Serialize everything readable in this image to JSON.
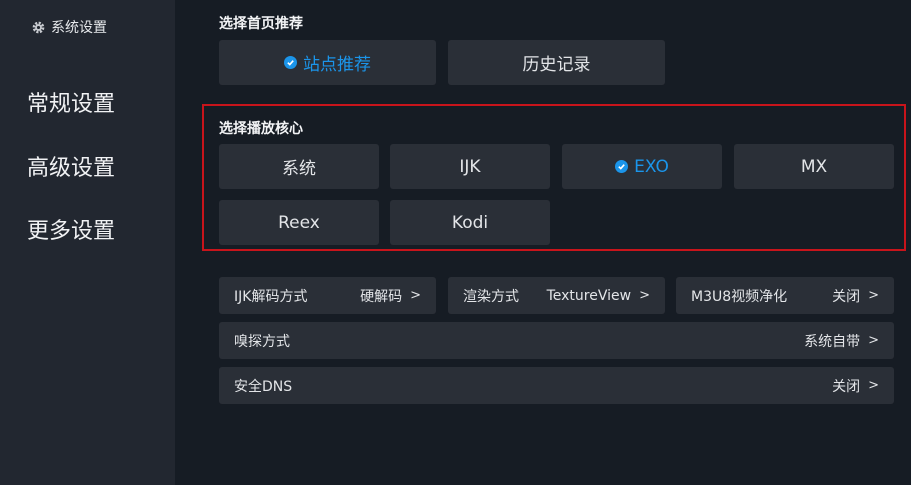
{
  "sidebar": {
    "title": "系统设置",
    "items": [
      {
        "label": "常规设置"
      },
      {
        "label": "高级设置"
      },
      {
        "label": "更多设置"
      }
    ]
  },
  "home_recommend": {
    "title": "选择首页推荐",
    "options": [
      {
        "label": "站点推荐",
        "selected": true
      },
      {
        "label": "历史记录",
        "selected": false
      }
    ]
  },
  "player_core": {
    "title": "选择播放核心",
    "options": [
      {
        "label": "系统",
        "selected": false
      },
      {
        "label": "IJK",
        "selected": false
      },
      {
        "label": "EXO",
        "selected": true
      },
      {
        "label": "MX",
        "selected": false
      },
      {
        "label": "Reex",
        "selected": false
      },
      {
        "label": "Kodi",
        "selected": false
      }
    ]
  },
  "settings": {
    "ijk_decode": {
      "label": "IJK解码方式",
      "value": "硬解码"
    },
    "render": {
      "label": "渲染方式",
      "value": "TextureView"
    },
    "m3u8_clean": {
      "label": "M3U8视频净化",
      "value": "关闭"
    },
    "sniff": {
      "label": "嗅探方式",
      "value": "系统自带"
    },
    "secure_dns": {
      "label": "安全DNS",
      "value": "关闭"
    },
    "arrow": ">"
  },
  "colors": {
    "accent": "#1b95ea",
    "highlight_frame": "#c8141b",
    "background": "#161c24",
    "sidebar": "#222730",
    "button": "#2a2f37"
  }
}
